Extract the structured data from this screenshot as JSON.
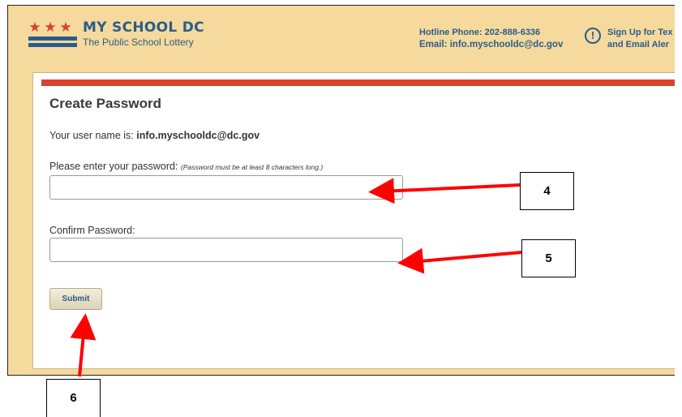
{
  "header": {
    "logo_title": "MY SCHOOL DC",
    "logo_subtitle": "The Public School Lottery",
    "hotline": "Hotline Phone: 202-888-6336",
    "email": "Email: info.myschooldc@dc.gov",
    "signup_line1": "Sign Up for Tex",
    "signup_line2": "and Email Aler"
  },
  "form": {
    "title": "Create Password",
    "username_prefix": "Your user name is:",
    "username_value": "info.myschooldc@dc.gov",
    "password_label": "Please enter your password:",
    "password_hint": "(Password must be at least 8 characters long.)",
    "password_value": "",
    "confirm_label": "Confirm Password:",
    "confirm_value": "",
    "submit_label": "Submit"
  },
  "callouts": {
    "c4": "4",
    "c5": "5",
    "c6": "6"
  },
  "colors": {
    "header_bg": "#f6d99d",
    "brand_blue": "#2a5d8a",
    "accent_red": "#d9412e",
    "arrow_red": "#ff0000"
  }
}
